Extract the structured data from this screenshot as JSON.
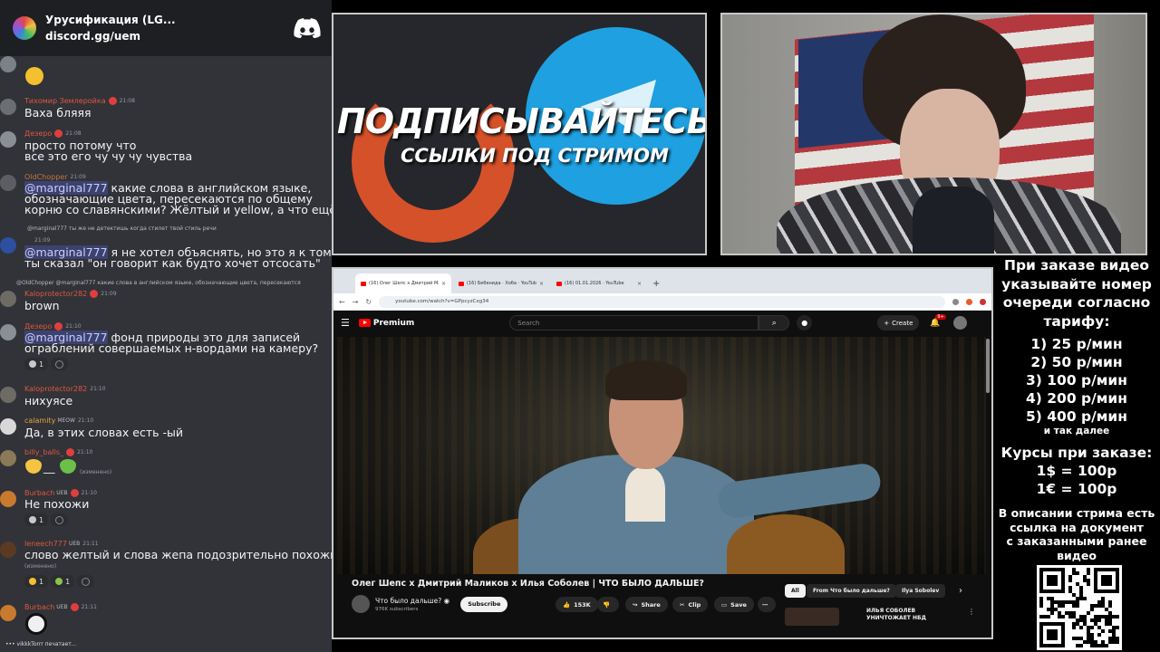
{
  "discord": {
    "server_name": "Урусификация (LG...",
    "invite": "discord.gg/uem",
    "typing": "vikkkTorrr печатает..."
  },
  "messages": [
    {
      "author": "Тихомир Землеройка",
      "time": "21:08",
      "text": "Ваха бляяя",
      "author_color": "#e0563f"
    },
    {
      "author": "Дезеро",
      "time": "21:08",
      "lines": [
        "просто потому что",
        "все это его чу чу чу чувства"
      ],
      "author_color": "#e0563f"
    },
    {
      "author": "OldChopper",
      "time": "21:09",
      "mention": "@marginal777",
      "lines": [
        " какие слова в английском языке,",
        "обозначающие цвета, пересекаются по общему",
        "корню со славянскими? Жёлтый и yellow, а что ещё?"
      ],
      "author_color": "#c0763f"
    },
    {
      "reply": "@marginal777 ты же не детектишь когда стилет твой стиль речи",
      "time": "21:09",
      "mention": "@marginal777",
      "lines": [
        " я не хотел объяснять, но это я к тому что",
        "ты сказал \"он говорит как будто хочет отсосать\""
      ]
    },
    {
      "reply": "@OldChopper @marginal777 какие слова в английском языке, обозначающие цвета, пересекаются",
      "author": "Kaloprotector282",
      "time": "21:09",
      "text": "brown",
      "author_color": "#e0563f"
    },
    {
      "author": "Дезеро",
      "time": "21:10",
      "mention": "@marginal777",
      "lines": [
        " фонд природы это для записей",
        "ограблений совершаемых  н-вордами на камеру?"
      ],
      "author_color": "#e0563f",
      "reaction_count": "1"
    },
    {
      "author": "Kaloprotector282",
      "time": "21:10",
      "text": "нихуясе",
      "author_color": "#e0563f"
    },
    {
      "author": "calamity",
      "tag": "MEOW",
      "time": "21:10",
      "text": "Да, в этих словах есть -ый",
      "author_color": "#e8a33b"
    },
    {
      "author": "billy_balls_",
      "time": "21:10",
      "text": "__",
      "edited": "(изменено)",
      "author_color": "#e0563f"
    },
    {
      "author": "Burbach",
      "tag": "UEB",
      "time": "21:10",
      "text": "Не похожи",
      "author_color": "#e0563f",
      "reaction_count": "1"
    },
    {
      "author": "Ieneech777",
      "tag": "UEB",
      "time": "21:11",
      "text": "слово желтый и слова жепа подозрительно похожи",
      "edited": "(изменено)",
      "author_color": "#e0563f",
      "reaction_counts": [
        "1",
        "1"
      ]
    },
    {
      "author": "Burbach",
      "tag": "UEB",
      "time": "21:11",
      "author_color": "#e0563f"
    }
  ],
  "banner": {
    "title": "ПОДПИСЫВАЙТЕСЬ",
    "caption": "ССЫЛКИ ПОД СТРИМОМ"
  },
  "browser": {
    "tabs": [
      "(16) Олег Шепс х Дмитрий Ма",
      "(16) Бебенида · Хоба · YouTube",
      "(16) 01.01.2026 · YouTube"
    ],
    "url": "youtube.com/watch?v=GPpcyzCxg34",
    "youtube": {
      "logo": "Premium",
      "search_placeholder": "Search",
      "create": "Create",
      "notifications": "9+",
      "video_title": "Олег Шепс х Дмитрий Маликов х Илья Соболев | ЧТО БЫЛО ДАЛЬШЕ?",
      "channel": "Что было дальше? ◉",
      "subscribers": "976K subscribers",
      "subscribe": "Subscribe",
      "likes": "153K",
      "share": "Share",
      "clip": "Clip",
      "save": "Save",
      "chips": [
        "All",
        "From Что было дальше?",
        "Ilya Sobolev"
      ],
      "rec_title_1": "ИЛЬЯ СОБОЛЕВ",
      "rec_title_2": "УНИЧТОЖАЕТ НБД"
    }
  },
  "info_panel": {
    "heading": [
      "При заказе видео",
      "указывайте номер",
      "очереди согласно",
      "тарифу:"
    ],
    "rates": [
      "1) 25 р/мин",
      "2) 50 р/мин",
      "3) 100 р/мин",
      "4) 200 р/мин",
      "5) 400 р/мин"
    ],
    "etc": "и так далее",
    "fx_heading": "Курсы при заказе:",
    "fx": [
      "1$ = 100р",
      "1€ = 100р"
    ],
    "desc": [
      "В описании стрима есть",
      "ссылка на документ",
      "с заказанными ранее",
      "видео"
    ]
  }
}
